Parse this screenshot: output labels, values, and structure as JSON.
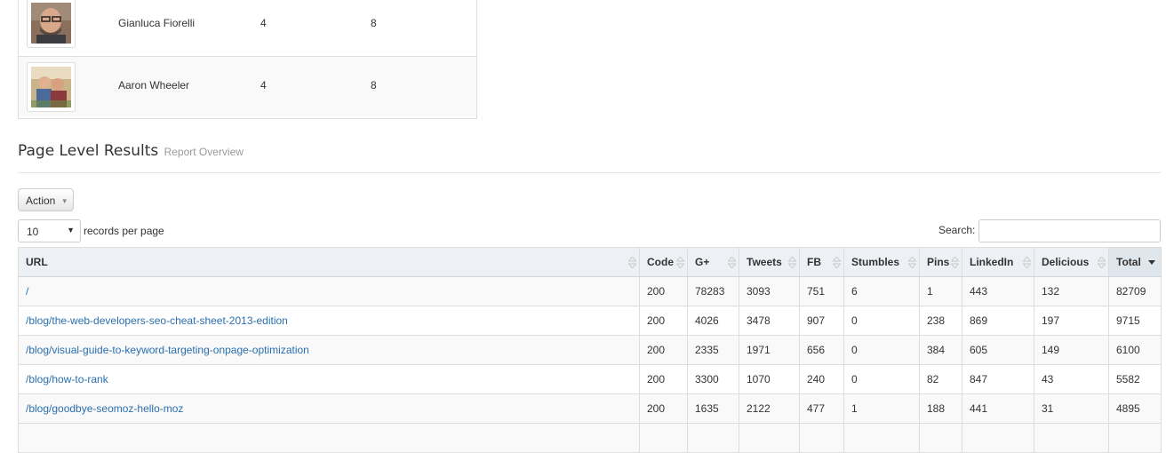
{
  "authors": [
    {
      "name": "Gianluca Fiorelli",
      "col1": "4",
      "col2": "8",
      "avatar_icon": "person-photo-icon"
    },
    {
      "name": "Aaron Wheeler",
      "col1": "4",
      "col2": "8",
      "avatar_icon": "people-photo-icon"
    }
  ],
  "section": {
    "title": "Page Level Results",
    "subtitle": "Report Overview"
  },
  "action": {
    "label": "Action"
  },
  "length": {
    "value": "10",
    "label": "records per page"
  },
  "search": {
    "label": "Search:",
    "value": ""
  },
  "table": {
    "columns": [
      "URL",
      "Code",
      "G+",
      "Tweets",
      "FB",
      "Stumbles",
      "Pins",
      "LinkedIn",
      "Delicious",
      "Total"
    ],
    "sorted_column": "Total",
    "link_color": "#2a6fb0",
    "rows": [
      [
        "/",
        "200",
        "78283",
        "3093",
        "751",
        "6",
        "1",
        "443",
        "132",
        "82709"
      ],
      [
        "/blog/the-web-developers-seo-cheat-sheet-2013-edition",
        "200",
        "4026",
        "3478",
        "907",
        "0",
        "238",
        "869",
        "197",
        "9715"
      ],
      [
        "/blog/visual-guide-to-keyword-targeting-onpage-optimization",
        "200",
        "2335",
        "1971",
        "656",
        "0",
        "384",
        "605",
        "149",
        "6100"
      ],
      [
        "/blog/how-to-rank",
        "200",
        "3300",
        "1070",
        "240",
        "0",
        "82",
        "847",
        "43",
        "5582"
      ],
      [
        "/blog/goodbye-seomoz-hello-moz",
        "200",
        "1635",
        "2122",
        "477",
        "1",
        "188",
        "441",
        "31",
        "4895"
      ]
    ]
  }
}
